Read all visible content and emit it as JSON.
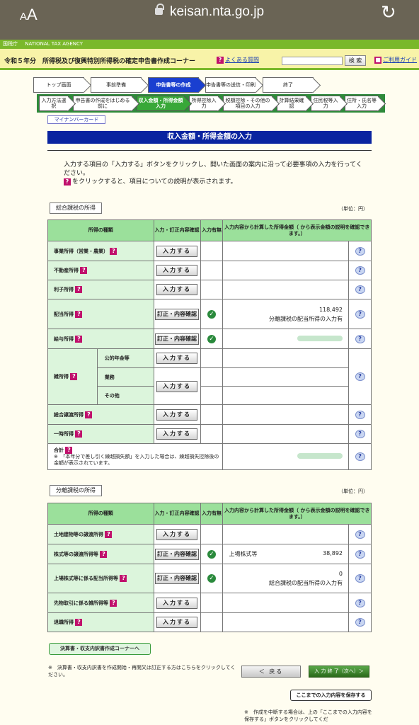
{
  "browser": {
    "text_size": "AA",
    "url": "keisan.nta.go.jp"
  },
  "header": {
    "agency": "国税庁",
    "agency_en": "NATIONAL TAX AGENCY",
    "title": "令和５年分　所得税及び復興特別所得税の確定申告書作成コーナー",
    "faq": "よくある質問",
    "search_button": "検 索",
    "guide": "ご利用ガイド"
  },
  "steps_top": [
    {
      "label": "トップ画面"
    },
    {
      "label": "事前準備"
    },
    {
      "label": "申告書等の作成",
      "current": true
    },
    {
      "label": "申告書等の送信・印刷"
    },
    {
      "label": "終了"
    }
  ],
  "steps_sub": [
    {
      "label": "入力方法選択"
    },
    {
      "label": "申告書の作成をはじめる前に"
    },
    {
      "label": "収入金額・所得金額入力",
      "current": true
    },
    {
      "label": "所得控除入力"
    },
    {
      "label": "税額控除・その他の項目の入力"
    },
    {
      "label": "計算結果確認"
    },
    {
      "label": "住民税等入力"
    },
    {
      "label": "住所・氏名等入力"
    }
  ],
  "mynumber": "マイナンバーカード",
  "page_title": "収入金額・所得金額の入力",
  "intro": {
    "line1": "入力する項目の「入力する」ボタンをクリックし、開いた画面の案内に沿って必要事項の入力を行ってください。",
    "line2": "をクリックすると、項目についての説明が表示されます。"
  },
  "unit": "（単位：円）",
  "table_headers": {
    "kind": "所得の種類",
    "input": "入力・訂正内容確認",
    "has": "入力有無",
    "amount": "入力内容から計算した所得金額（ から表示金額の説明を確認できます。）"
  },
  "buttons": {
    "input": "入力する",
    "edit": "訂正・内容確認"
  },
  "general": {
    "label": "総合課税の所得",
    "rows": {
      "business": "事業所得（営業・農業）",
      "realestate": "不動産所得",
      "interest": "利子所得",
      "dividend": "配当所得",
      "dividend_amount": "118,492",
      "dividend_note": "分離課税の配当所得の入力有",
      "salary": "給与所得",
      "misc": "雑所得",
      "misc_pension": "公的年金等",
      "misc_business": "業務",
      "misc_other": "その他",
      "transfer": "総合譲渡所得",
      "temporary": "一時所得",
      "total": "合計",
      "total_note": "※　「本年分で差し引く繰越損失額」を入力した場合は、繰越損失控除後の金額が表示されています。"
    }
  },
  "separate": {
    "label": "分離課税の所得",
    "rows": {
      "land": "土地建物等の譲渡所得",
      "stock": "株式等の譲渡所得等",
      "stock_sub": "上場株式等",
      "stock_amount": "38,892",
      "listed_dividend": "上場株式等に係る配当所得等",
      "listed_dividend_amount": "0",
      "listed_dividend_note": "総合課税の配当所得の入力有",
      "futures": "先物取引に係る雑所得等",
      "retirement": "退職所得"
    }
  },
  "footer": {
    "settle_button": "決算書・収支内訳書作成コーナーへ",
    "settle_note": "※　決算書・収支内訳書を作成開始・再開又は訂正する方はこちらをクリックしてください。",
    "back_button": "＜ 戻る",
    "next_button": "入 力 終 了（次へ）＞",
    "save_button": "ここまでの入力内容を保存する",
    "save_note": "※　作成を中断する場合は、上の「ここまでの入力内容を保存する」ボタンをクリックしてくだ"
  }
}
